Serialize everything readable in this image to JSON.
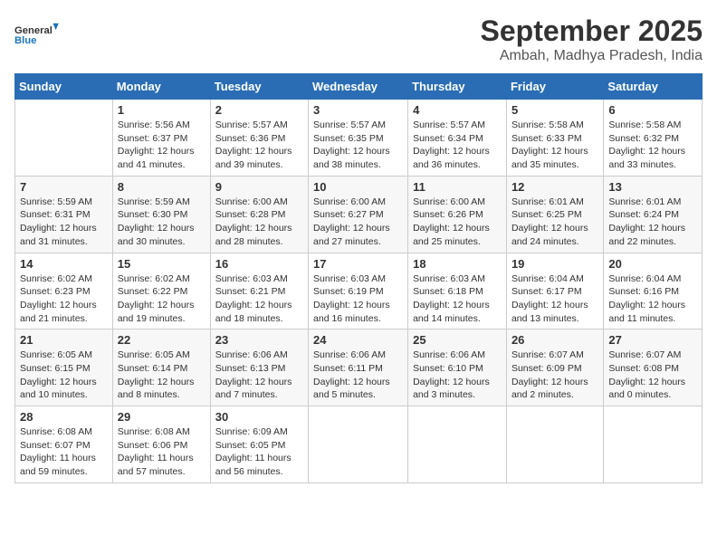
{
  "logo": {
    "line1": "General",
    "line2": "Blue"
  },
  "title": "September 2025",
  "subtitle": "Ambah, Madhya Pradesh, India",
  "weekdays": [
    "Sunday",
    "Monday",
    "Tuesday",
    "Wednesday",
    "Thursday",
    "Friday",
    "Saturday"
  ],
  "weeks": [
    [
      {
        "day": "",
        "info": ""
      },
      {
        "day": "1",
        "info": "Sunrise: 5:56 AM\nSunset: 6:37 PM\nDaylight: 12 hours\nand 41 minutes."
      },
      {
        "day": "2",
        "info": "Sunrise: 5:57 AM\nSunset: 6:36 PM\nDaylight: 12 hours\nand 39 minutes."
      },
      {
        "day": "3",
        "info": "Sunrise: 5:57 AM\nSunset: 6:35 PM\nDaylight: 12 hours\nand 38 minutes."
      },
      {
        "day": "4",
        "info": "Sunrise: 5:57 AM\nSunset: 6:34 PM\nDaylight: 12 hours\nand 36 minutes."
      },
      {
        "day": "5",
        "info": "Sunrise: 5:58 AM\nSunset: 6:33 PM\nDaylight: 12 hours\nand 35 minutes."
      },
      {
        "day": "6",
        "info": "Sunrise: 5:58 AM\nSunset: 6:32 PM\nDaylight: 12 hours\nand 33 minutes."
      }
    ],
    [
      {
        "day": "7",
        "info": "Sunrise: 5:59 AM\nSunset: 6:31 PM\nDaylight: 12 hours\nand 31 minutes."
      },
      {
        "day": "8",
        "info": "Sunrise: 5:59 AM\nSunset: 6:30 PM\nDaylight: 12 hours\nand 30 minutes."
      },
      {
        "day": "9",
        "info": "Sunrise: 6:00 AM\nSunset: 6:28 PM\nDaylight: 12 hours\nand 28 minutes."
      },
      {
        "day": "10",
        "info": "Sunrise: 6:00 AM\nSunset: 6:27 PM\nDaylight: 12 hours\nand 27 minutes."
      },
      {
        "day": "11",
        "info": "Sunrise: 6:00 AM\nSunset: 6:26 PM\nDaylight: 12 hours\nand 25 minutes."
      },
      {
        "day": "12",
        "info": "Sunrise: 6:01 AM\nSunset: 6:25 PM\nDaylight: 12 hours\nand 24 minutes."
      },
      {
        "day": "13",
        "info": "Sunrise: 6:01 AM\nSunset: 6:24 PM\nDaylight: 12 hours\nand 22 minutes."
      }
    ],
    [
      {
        "day": "14",
        "info": "Sunrise: 6:02 AM\nSunset: 6:23 PM\nDaylight: 12 hours\nand 21 minutes."
      },
      {
        "day": "15",
        "info": "Sunrise: 6:02 AM\nSunset: 6:22 PM\nDaylight: 12 hours\nand 19 minutes."
      },
      {
        "day": "16",
        "info": "Sunrise: 6:03 AM\nSunset: 6:21 PM\nDaylight: 12 hours\nand 18 minutes."
      },
      {
        "day": "17",
        "info": "Sunrise: 6:03 AM\nSunset: 6:19 PM\nDaylight: 12 hours\nand 16 minutes."
      },
      {
        "day": "18",
        "info": "Sunrise: 6:03 AM\nSunset: 6:18 PM\nDaylight: 12 hours\nand 14 minutes."
      },
      {
        "day": "19",
        "info": "Sunrise: 6:04 AM\nSunset: 6:17 PM\nDaylight: 12 hours\nand 13 minutes."
      },
      {
        "day": "20",
        "info": "Sunrise: 6:04 AM\nSunset: 6:16 PM\nDaylight: 12 hours\nand 11 minutes."
      }
    ],
    [
      {
        "day": "21",
        "info": "Sunrise: 6:05 AM\nSunset: 6:15 PM\nDaylight: 12 hours\nand 10 minutes."
      },
      {
        "day": "22",
        "info": "Sunrise: 6:05 AM\nSunset: 6:14 PM\nDaylight: 12 hours\nand 8 minutes."
      },
      {
        "day": "23",
        "info": "Sunrise: 6:06 AM\nSunset: 6:13 PM\nDaylight: 12 hours\nand 7 minutes."
      },
      {
        "day": "24",
        "info": "Sunrise: 6:06 AM\nSunset: 6:11 PM\nDaylight: 12 hours\nand 5 minutes."
      },
      {
        "day": "25",
        "info": "Sunrise: 6:06 AM\nSunset: 6:10 PM\nDaylight: 12 hours\nand 3 minutes."
      },
      {
        "day": "26",
        "info": "Sunrise: 6:07 AM\nSunset: 6:09 PM\nDaylight: 12 hours\nand 2 minutes."
      },
      {
        "day": "27",
        "info": "Sunrise: 6:07 AM\nSunset: 6:08 PM\nDaylight: 12 hours\nand 0 minutes."
      }
    ],
    [
      {
        "day": "28",
        "info": "Sunrise: 6:08 AM\nSunset: 6:07 PM\nDaylight: 11 hours\nand 59 minutes."
      },
      {
        "day": "29",
        "info": "Sunrise: 6:08 AM\nSunset: 6:06 PM\nDaylight: 11 hours\nand 57 minutes."
      },
      {
        "day": "30",
        "info": "Sunrise: 6:09 AM\nSunset: 6:05 PM\nDaylight: 11 hours\nand 56 minutes."
      },
      {
        "day": "",
        "info": ""
      },
      {
        "day": "",
        "info": ""
      },
      {
        "day": "",
        "info": ""
      },
      {
        "day": "",
        "info": ""
      }
    ]
  ]
}
